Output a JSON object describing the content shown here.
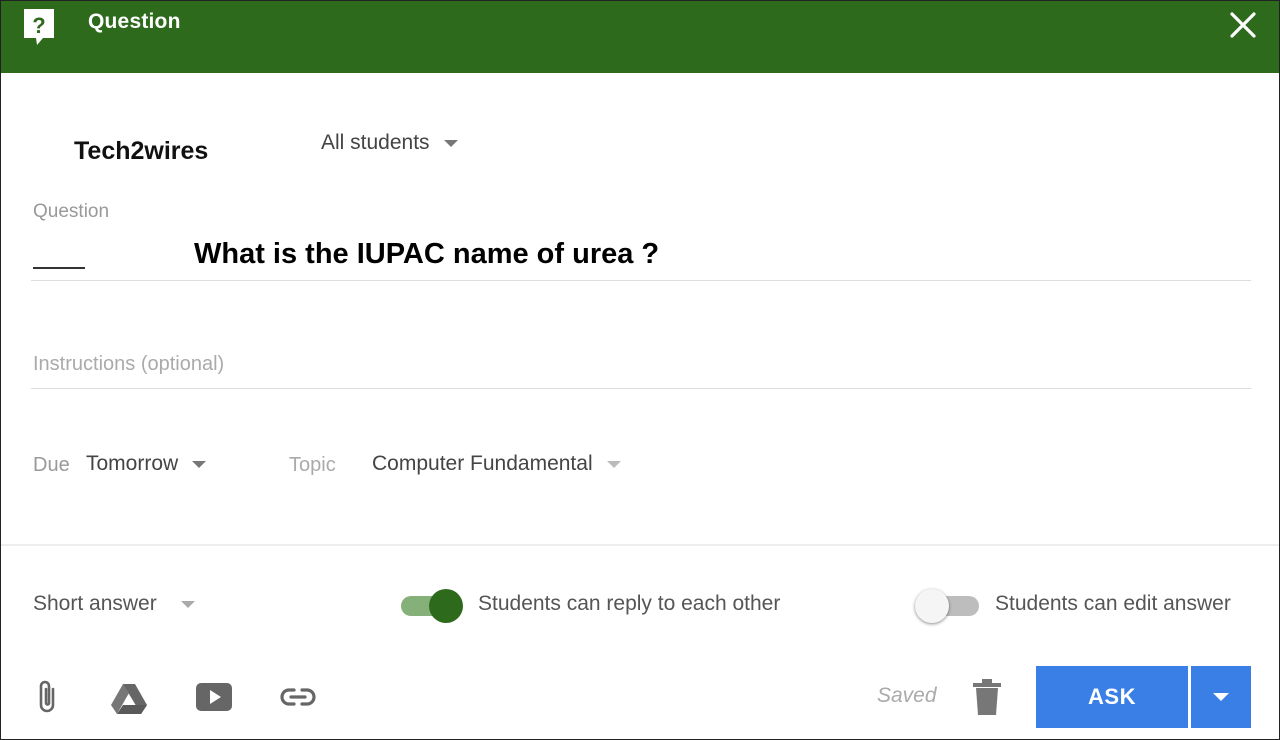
{
  "header": {
    "title": "Question",
    "background": "#2e6a1c"
  },
  "brand": "Tech2wires",
  "assign": {
    "value": "All students"
  },
  "question": {
    "label": "Question",
    "text": "What is the IUPAC name of urea ?"
  },
  "instructions": {
    "placeholder": "Instructions (optional)"
  },
  "due": {
    "label": "Due",
    "value": "Tomorrow"
  },
  "topic": {
    "label": "Topic",
    "value": "Computer Fundamental"
  },
  "answer_type": {
    "value": "Short answer"
  },
  "toggles": {
    "reply": {
      "label": "Students can reply to each other",
      "on": true
    },
    "edit": {
      "label": "Students can edit answer",
      "on": false
    }
  },
  "toolbar": {
    "icons": [
      "paperclip-icon",
      "google-drive-icon",
      "youtube-icon",
      "link-icon",
      "trash-icon"
    ],
    "status": "Saved",
    "ask_label": "ASK",
    "accent": "#3a7fe6"
  }
}
